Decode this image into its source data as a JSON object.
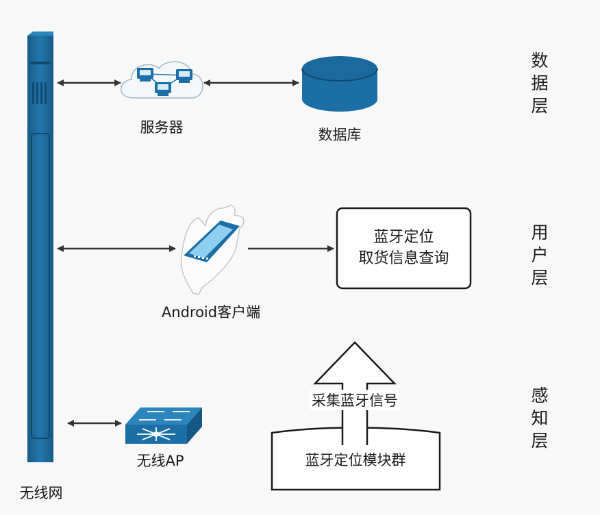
{
  "network": {
    "label": "无线网"
  },
  "nodes": {
    "server": {
      "label": "服务器"
    },
    "database": {
      "label": "数据库"
    },
    "android_client": {
      "label": "Android客户端"
    },
    "wireless_ap": {
      "label": "无线AP"
    }
  },
  "query_box": {
    "line1": "蓝牙定位",
    "line2": "取货信息查询"
  },
  "collect_arrow": {
    "label": "采集蓝牙信号"
  },
  "beacon_group": {
    "label": "蓝牙定位模块群"
  },
  "layers": {
    "data": "数据层",
    "user": "用户层",
    "sensing": "感知层"
  },
  "colors": {
    "network_bar": "#1a5f8c",
    "device_blue": "#1b6fa6",
    "arrow": "#333333"
  }
}
